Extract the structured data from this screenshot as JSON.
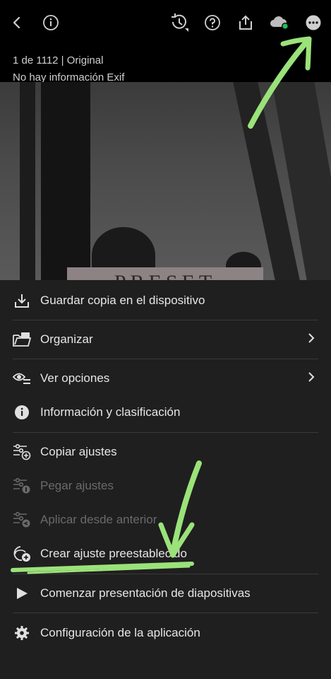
{
  "info": {
    "counter": "1 de 1112 | Original",
    "exif": "No hay información Exif"
  },
  "photo": {
    "overlay_text": "PRESET"
  },
  "menu": {
    "items": [
      {
        "label": "Guardar copia en el dispositivo",
        "icon": "download-icon"
      },
      {
        "label": "Organizar",
        "icon": "folder-image-icon"
      },
      {
        "label": "Ver opciones",
        "icon": "view-options-icon"
      },
      {
        "label": "Información y clasificación",
        "icon": "info-icon"
      },
      {
        "label": "Copiar ajustes",
        "icon": "copy-settings-icon"
      },
      {
        "label": "Pegar ajustes",
        "icon": "paste-settings-icon"
      },
      {
        "label": "Aplicar desde anterior",
        "icon": "apply-previous-icon"
      },
      {
        "label": "Crear ajuste preestablecido",
        "icon": "create-preset-icon"
      },
      {
        "label": "Comenzar presentación de diapositivas",
        "icon": "play-icon"
      },
      {
        "label": "Configuración de la aplicación",
        "icon": "gear-icon"
      }
    ]
  },
  "colors": {
    "annotation": "#9be27a",
    "sync_status": "#21c05a"
  }
}
